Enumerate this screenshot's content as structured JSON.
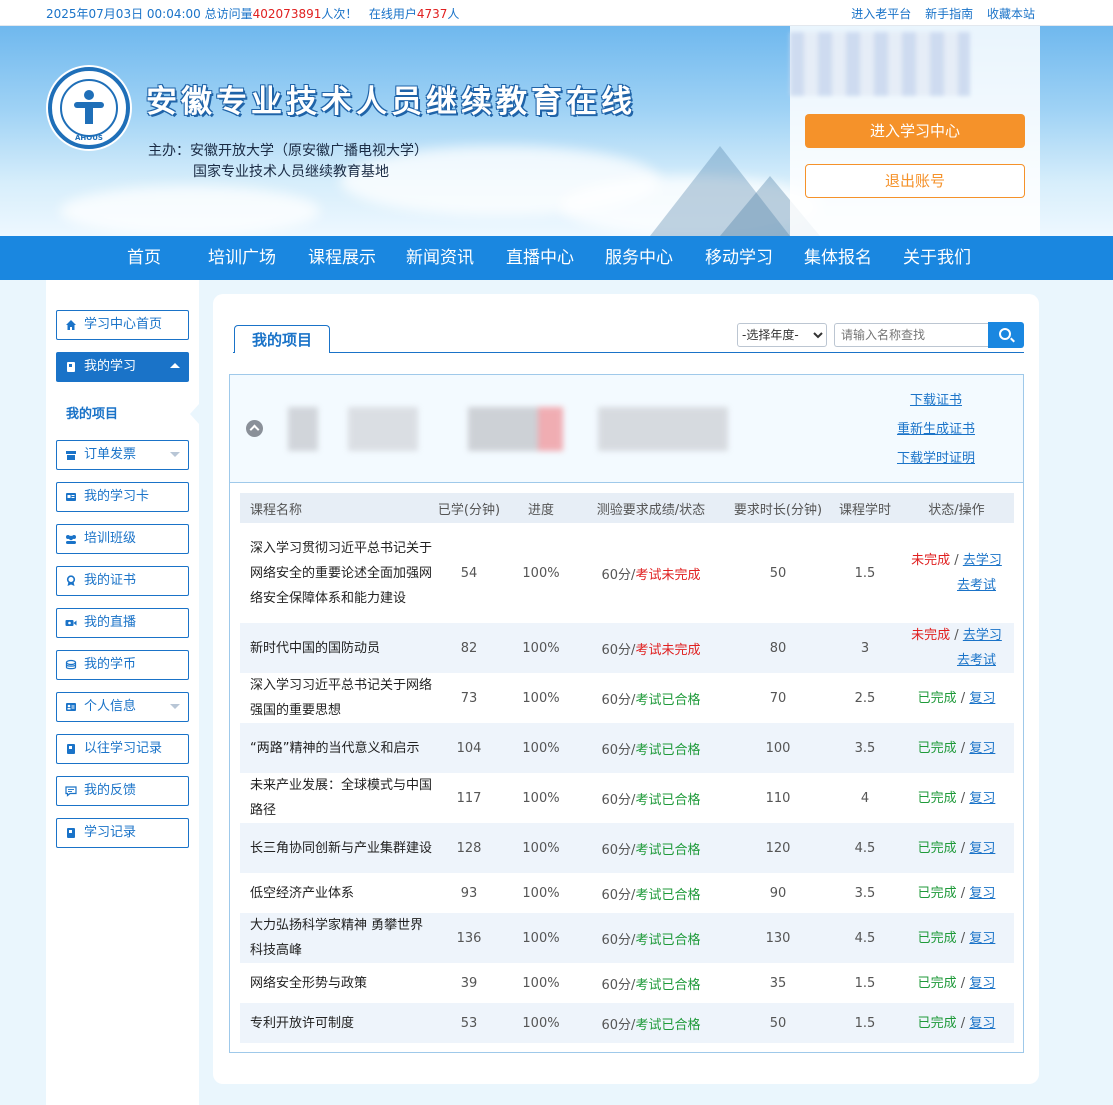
{
  "topbar": {
    "datetime": "2025年07月03日 00:04:00",
    "visits_label": "总访问量",
    "visits_count": "402073891",
    "visits_suffix": "人次！",
    "online_label": "在线用户",
    "online_count": "4737",
    "online_suffix": "人",
    "links": [
      "进入老平台",
      "新手指南",
      "收藏本站"
    ]
  },
  "banner": {
    "logo_text": "AHOUS",
    "site_title": "安徽专业技术人员继续教育在线",
    "host_line1": "主办：安徽开放大学（原安徽广播电视大学）",
    "host_line2": "国家专业技术人员继续教育基地",
    "enter_center_label": "进入学习中心",
    "logout_label": "退出账号"
  },
  "nav": {
    "items": [
      "首页",
      "培训广场",
      "课程展示",
      "新闻资讯",
      "直播中心",
      "服务中心",
      "移动学习",
      "集体报名",
      "关于我们"
    ]
  },
  "sidebar": {
    "items": [
      {
        "label": "学习中心首页",
        "icon": "home-icon"
      },
      {
        "label": "我的学习",
        "icon": "book-icon"
      },
      {
        "label": "订单发票",
        "icon": "invoice-icon"
      },
      {
        "label": "我的学习卡",
        "icon": "card-icon"
      },
      {
        "label": "培训班级",
        "icon": "group-icon"
      },
      {
        "label": "我的证书",
        "icon": "certificate-icon"
      },
      {
        "label": "我的直播",
        "icon": "video-icon"
      },
      {
        "label": "我的学币",
        "icon": "coin-icon"
      },
      {
        "label": "个人信息",
        "icon": "profile-icon"
      },
      {
        "label": "以往学习记录",
        "icon": "book-icon"
      },
      {
        "label": "我的反馈",
        "icon": "feedback-icon"
      },
      {
        "label": "学习记录",
        "icon": "book-icon"
      }
    ],
    "sub_item": "我的项目"
  },
  "content": {
    "tab_label": "我的项目",
    "year_select": "-选择年度-",
    "search_placeholder": "请输入名称查找",
    "project_links": [
      "下载证书",
      "重新生成证书",
      "下载学时证明"
    ]
  },
  "table": {
    "headers": [
      "课程名称",
      "已学(分钟)",
      "进度",
      "测验要求成绩/状态",
      "要求时长(分钟)",
      "课程学时",
      "状态/操作"
    ],
    "score_prefix": "60分/",
    "rows": [
      {
        "name": "深入学习贯彻习近平总书记关于网络安全的重要论述全面加强网络安全保障体系和能力建设",
        "learned": "54",
        "progress": "100%",
        "exam": "考试未完成",
        "required": "50",
        "hours": "1.5",
        "status": "未完成",
        "ops": [
          "去学习",
          "去考试"
        ],
        "done": false
      },
      {
        "name": "新时代中国的国防动员",
        "learned": "82",
        "progress": "100%",
        "exam": "考试未完成",
        "required": "80",
        "hours": "3",
        "status": "未完成",
        "ops": [
          "去学习",
          "去考试"
        ],
        "done": false
      },
      {
        "name": "深入学习习近平总书记关于网络强国的重要思想",
        "learned": "73",
        "progress": "100%",
        "exam": "考试已合格",
        "required": "70",
        "hours": "2.5",
        "status": "已完成",
        "ops": [
          "复习"
        ],
        "done": true
      },
      {
        "name": "“两路”精神的当代意义和启示",
        "learned": "104",
        "progress": "100%",
        "exam": "考试已合格",
        "required": "100",
        "hours": "3.5",
        "status": "已完成",
        "ops": [
          "复习"
        ],
        "done": true
      },
      {
        "name": "未来产业发展：全球模式与中国路径",
        "learned": "117",
        "progress": "100%",
        "exam": "考试已合格",
        "required": "110",
        "hours": "4",
        "status": "已完成",
        "ops": [
          "复习"
        ],
        "done": true
      },
      {
        "name": "长三角协同创新与产业集群建设",
        "learned": "128",
        "progress": "100%",
        "exam": "考试已合格",
        "required": "120",
        "hours": "4.5",
        "status": "已完成",
        "ops": [
          "复习"
        ],
        "done": true
      },
      {
        "name": "低空经济产业体系",
        "learned": "93",
        "progress": "100%",
        "exam": "考试已合格",
        "required": "90",
        "hours": "3.5",
        "status": "已完成",
        "ops": [
          "复习"
        ],
        "done": true
      },
      {
        "name": "大力弘扬科学家精神 勇攀世界科技高峰",
        "learned": "136",
        "progress": "100%",
        "exam": "考试已合格",
        "required": "130",
        "hours": "4.5",
        "status": "已完成",
        "ops": [
          "复习"
        ],
        "done": true
      },
      {
        "name": "网络安全形势与政策",
        "learned": "39",
        "progress": "100%",
        "exam": "考试已合格",
        "required": "35",
        "hours": "1.5",
        "status": "已完成",
        "ops": [
          "复习"
        ],
        "done": true
      },
      {
        "name": "专利开放许可制度",
        "learned": "53",
        "progress": "100%",
        "exam": "考试已合格",
        "required": "50",
        "hours": "1.5",
        "status": "已完成",
        "ops": [
          "复习"
        ],
        "done": true
      }
    ]
  }
}
